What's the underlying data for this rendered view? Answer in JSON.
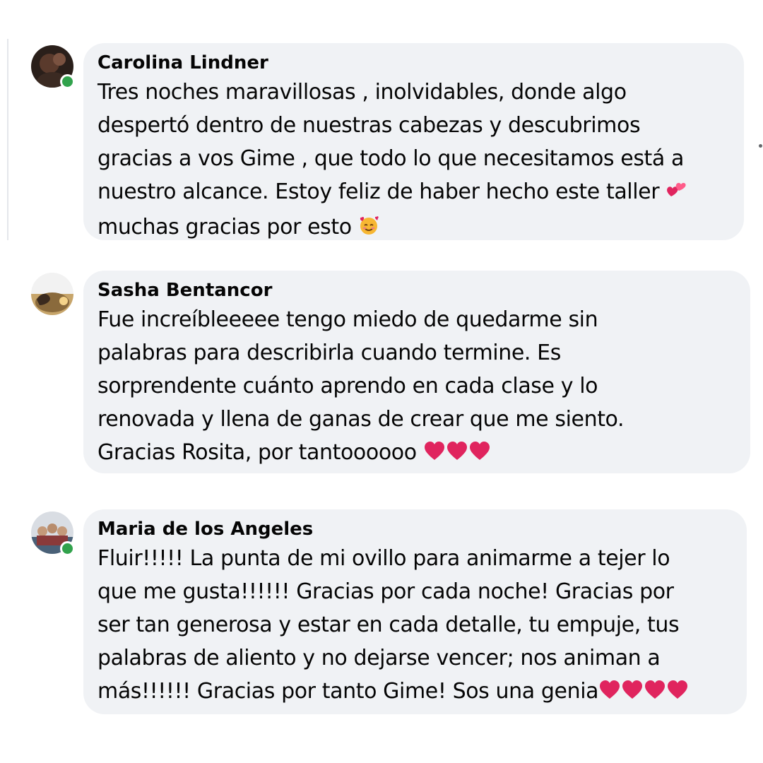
{
  "comments": [
    {
      "author": "Carolina Lindner",
      "online": true,
      "avatar_icon": "profile-photo",
      "lines": [
        "Tres noches maravillosas , inolvidables, donde algo",
        "despertó dentro de nuestras cabezas y descubrimos",
        "gracias a vos Gime , que todo lo que necesitamos está a",
        "nuestro alcance. Estoy feliz de haber hecho este taller",
        "muchas gracias por esto"
      ],
      "emojis": [
        "two-hearts-emoji",
        "smiling-face-with-hearts-emoji"
      ]
    },
    {
      "author": "Sasha Bentancor",
      "online": false,
      "avatar_icon": "profile-photo",
      "lines": [
        "Fue increíbleeeee tengo miedo de quedarme sin",
        "palabras para describirla cuando termine. Es",
        "sorprendente cuánto aprendo en cada clase y lo",
        "renovada y llena de ganas de crear que me siento.",
        "Gracias Rosita, por tantoooooo"
      ],
      "emojis": [
        "red-heart-emoji",
        "red-heart-emoji",
        "red-heart-emoji"
      ]
    },
    {
      "author": "Maria de los Angeles",
      "online": true,
      "avatar_icon": "profile-photo",
      "lines": [
        "Fluir!!!!! La punta de mi ovillo para animarme a tejer lo",
        "que me gusta!!!!!! Gracias por cada noche! Gracias por",
        "ser tan generosa y estar en cada detalle, tu empuje, tus",
        "palabras de aliento y no dejarse vencer; nos animan a",
        "más!!!!!! Gracias por tanto Gime! Sos una genia"
      ],
      "emojis": [
        "red-heart-emoji",
        "red-heart-emoji",
        "red-heart-emoji",
        "red-heart-emoji"
      ]
    }
  ],
  "colors": {
    "bubble": "#f0f2f5",
    "text": "#050505",
    "online": "#31a24c",
    "heart": "#e0245e"
  }
}
